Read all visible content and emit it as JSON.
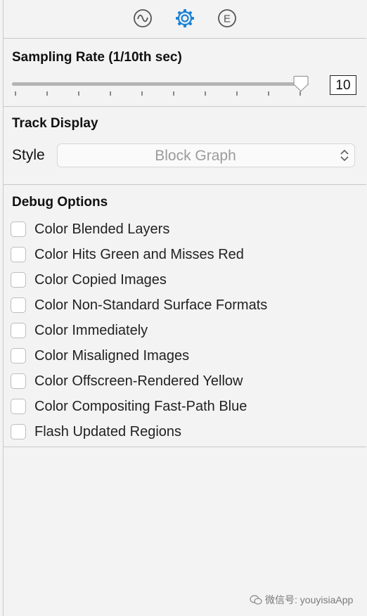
{
  "toolbar": {
    "tabs": [
      {
        "icon": "waveform-icon",
        "selected": false
      },
      {
        "icon": "gear-icon",
        "selected": true
      },
      {
        "icon": "e-circle-icon",
        "selected": false,
        "glyph": "E"
      }
    ],
    "accent_color": "#1a82d6"
  },
  "sampling": {
    "title": "Sampling Rate (1/10th sec)",
    "slider_value": 10,
    "slider_max": 10,
    "value_text": "10"
  },
  "track_display": {
    "title": "Track Display",
    "style_label": "Style",
    "style_value": "Block Graph"
  },
  "debug_options": {
    "title": "Debug Options",
    "items": [
      {
        "label": "Color Blended Layers",
        "checked": false
      },
      {
        "label": "Color Hits Green and Misses Red",
        "checked": false
      },
      {
        "label": "Color Copied Images",
        "checked": false
      },
      {
        "label": "Color Non-Standard Surface Formats",
        "checked": false
      },
      {
        "label": "Color Immediately",
        "checked": false
      },
      {
        "label": "Color Misaligned Images",
        "checked": false
      },
      {
        "label": "Color Offscreen-Rendered Yellow",
        "checked": false
      },
      {
        "label": "Color Compositing Fast-Path Blue",
        "checked": false
      },
      {
        "label": "Flash Updated Regions",
        "checked": false
      }
    ]
  },
  "watermark": {
    "text": "微信号: youyisiaApp",
    "icon": "wechat-icon"
  }
}
